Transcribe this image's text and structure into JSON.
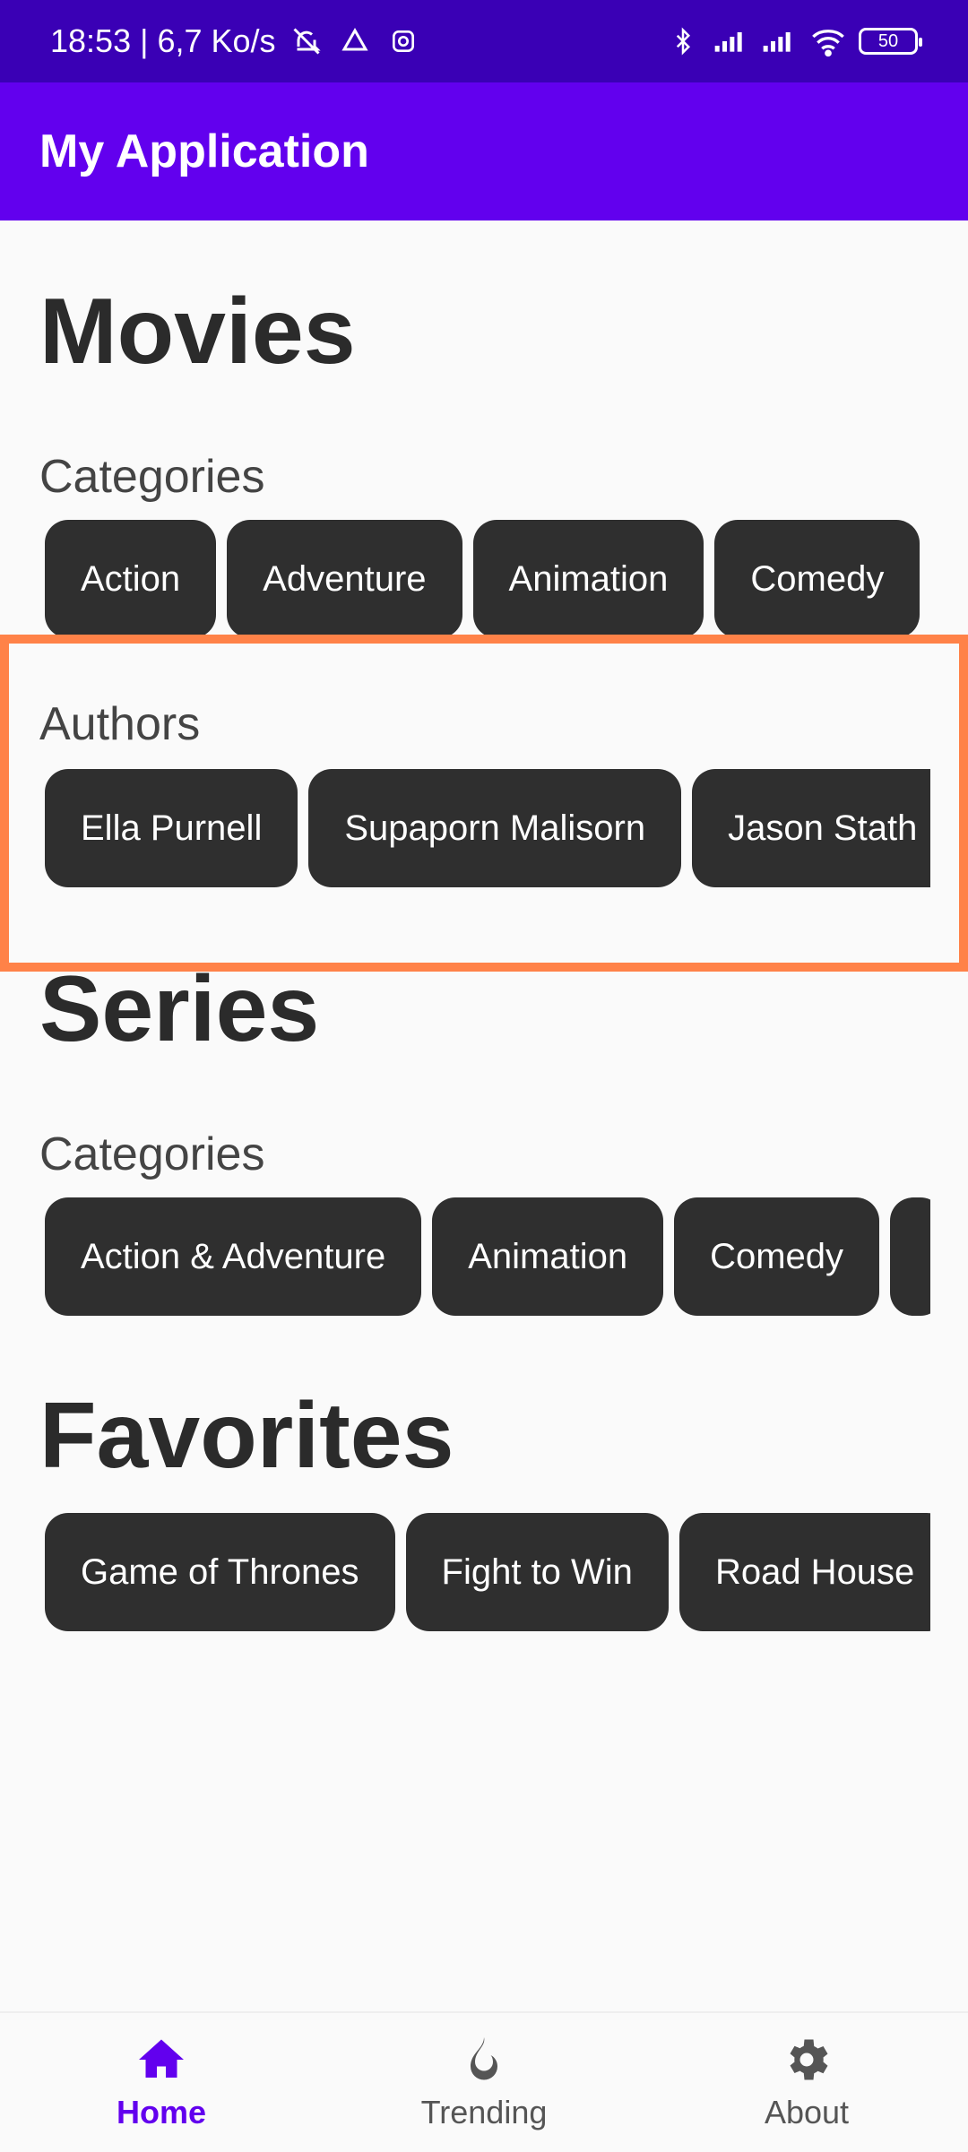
{
  "status": {
    "time_speed": "18:53 | 6,7 Ko/s",
    "battery": "50"
  },
  "app_bar": {
    "title": "My Application"
  },
  "movies": {
    "title": "Movies",
    "categories_label": "Categories",
    "categories": [
      "Action",
      "Adventure",
      "Animation",
      "Comedy"
    ],
    "authors_label": "Authors",
    "authors": [
      "Ella Purnell",
      "Supaporn Malisorn",
      "Jason Stath"
    ]
  },
  "series": {
    "title": "Series",
    "categories_label": "Categories",
    "categories": [
      "Action & Adventure",
      "Animation",
      "Comedy"
    ]
  },
  "favorites": {
    "title": "Favorites",
    "items": [
      "Game of Thrones",
      "Fight to Win",
      "Road House"
    ]
  },
  "nav": {
    "home": "Home",
    "trending": "Trending",
    "about": "About"
  },
  "colors": {
    "status_bar": "#3A00B5",
    "app_bar": "#6200EE",
    "chip_bg": "#2F2F2F",
    "highlight": "#FF8248",
    "active_nav": "#6200EE"
  },
  "icons": {
    "notifications_off": "bell-off-icon",
    "drive": "drive-icon",
    "instagram": "instagram-icon",
    "bluetooth": "bluetooth-icon",
    "signal": "signal-icon",
    "wifi": "wifi-icon",
    "home": "home-icon",
    "trending": "fire-icon",
    "about": "gear-icon"
  }
}
